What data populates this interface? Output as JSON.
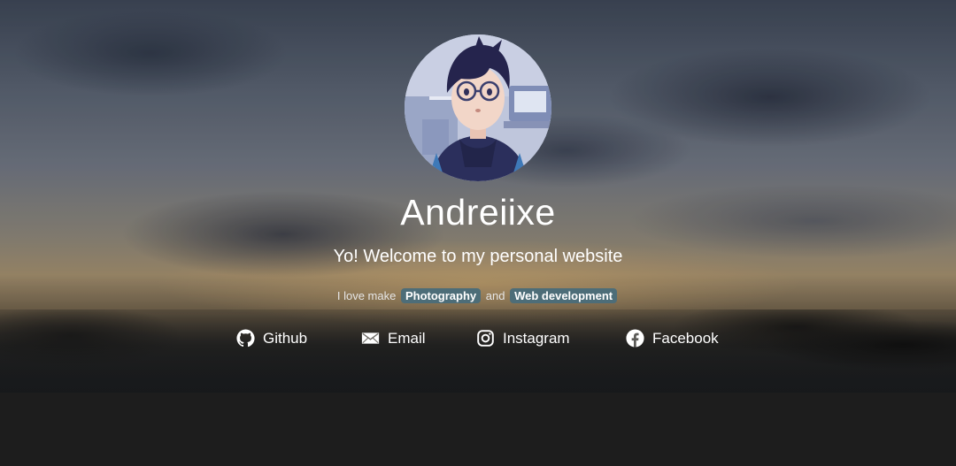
{
  "profile": {
    "name": "Andreiixe",
    "welcome": "Yo! Welcome to my personal website",
    "avatar_alt": "avatar"
  },
  "tagline": {
    "prefix": "I love make",
    "tag1": "Photography",
    "conjunction": "and",
    "tag2": "Web development"
  },
  "links": [
    {
      "label": "Github",
      "icon": "github-icon"
    },
    {
      "label": "Email",
      "icon": "envelope-icon"
    },
    {
      "label": "Instagram",
      "icon": "instagram-icon"
    },
    {
      "label": "Facebook",
      "icon": "facebook-icon"
    }
  ],
  "colors": {
    "tag_bg": "#4d6d78",
    "text": "#ffffff",
    "page_bg": "#1d1d1d"
  }
}
